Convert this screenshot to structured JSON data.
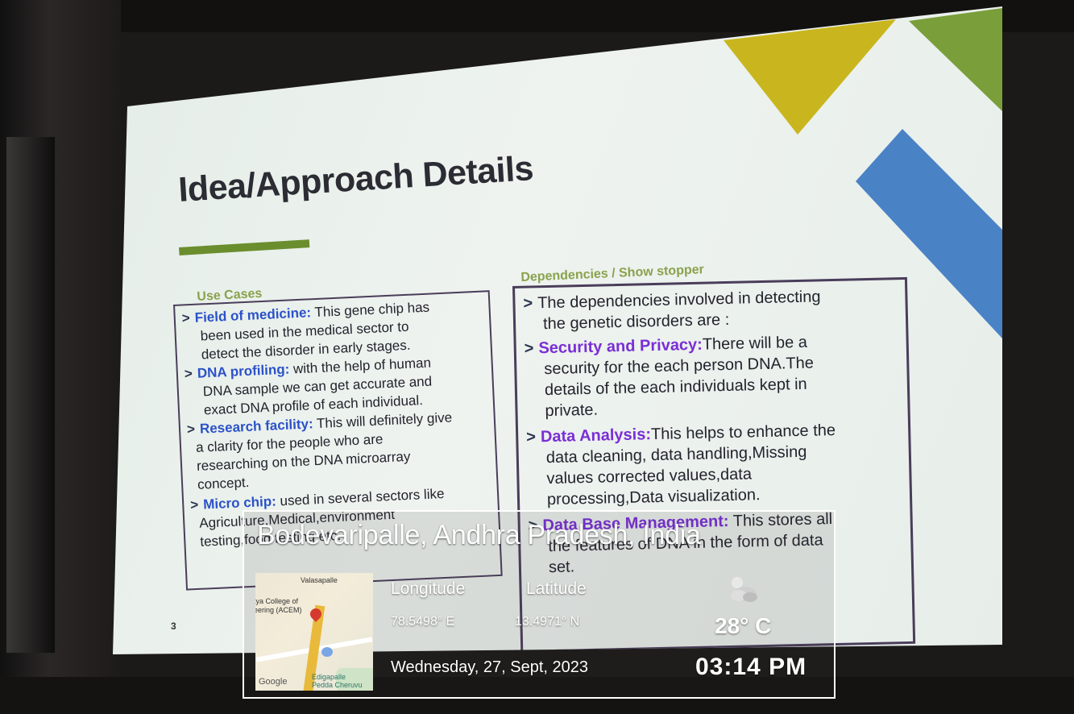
{
  "slide": {
    "title": "Idea/Approach Details",
    "slide_number": "3",
    "use_cases": {
      "heading": "Use Cases",
      "items": [
        {
          "keyword": "Field of medicine:",
          "lines": [
            " This gene chip has",
            "been used in the medical sector to",
            "detect the disorder in early stages."
          ]
        },
        {
          "keyword": "DNA profiling:",
          "lines": [
            " with the help of human",
            "DNA sample we can get accurate and",
            "exact DNA profile of each individual."
          ]
        },
        {
          "keyword": "Research facility:",
          "lines": [
            " This will definitely give",
            "a clarity for the people who are",
            "researching on the DNA microarray",
            "concept."
          ]
        },
        {
          "keyword": "Micro chip:",
          "lines": [
            " used in several sectors like",
            "Agriculture,Medical,environment",
            "testing,food testing etc."
          ]
        }
      ]
    },
    "dependencies": {
      "heading": "Dependencies / Show stopper",
      "items": [
        {
          "keyword": "",
          "lines": [
            "The dependencies involved in detecting",
            "the genetic disorders are :"
          ]
        },
        {
          "keyword": "Security and Privacy:",
          "lines": [
            "There will be a",
            "security for the each person DNA.The",
            "details of the each individuals kept in",
            "private."
          ]
        },
        {
          "keyword": "Data Analysis:",
          "lines": [
            "This helps to enhance the",
            "data cleaning, data handling,Missing",
            "values corrected values,data",
            "processing,Data visualization."
          ]
        },
        {
          "keyword": "Data Base Management:",
          "lines": [
            " This stores all",
            "the features of DNA in the form of data",
            "set."
          ]
        }
      ]
    },
    "colors": {
      "keyword_left": "#2b52c8",
      "keyword_right": "#7a2ed6",
      "heading": "#8aa24c",
      "accent_yellow": "#c9b61e",
      "accent_green": "#7a9e3a",
      "accent_blue": "#4a82c6"
    }
  },
  "overlay": {
    "location": "Bodevaripalle, Andhra Pradesh, India",
    "longitude_label": "Longitude",
    "longitude_value": "78.5498° E",
    "latitude_label": "Latitude",
    "latitude_value": "13.4971° N",
    "date": "Wednesday, 27, Sept, 2023",
    "temperature": "28° C",
    "time": "03:14 PM",
    "weather_icon": "partly-cloudy-icon",
    "map": {
      "place_top": "Valasapalle",
      "college_line1": "tya College of",
      "college_line2": "eering (ACEM)",
      "logo": "Google",
      "lake_line1": "Edigapalle",
      "lake_line2": "Pedda Cheruvu"
    }
  }
}
